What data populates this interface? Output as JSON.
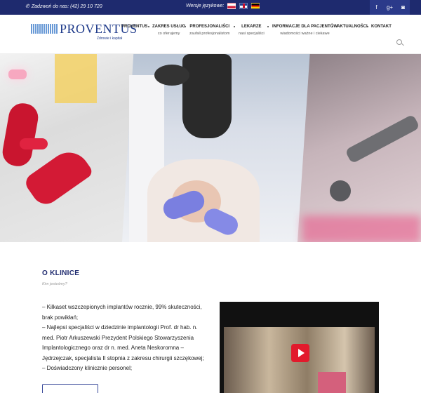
{
  "topbar": {
    "phone": "Zadzwoń do nas: (42) 29 10 720",
    "versions_label": "Wersje językowe:",
    "flags": [
      "flag-pl",
      "flag-en",
      "flag-de"
    ],
    "social": [
      {
        "icon": "facebook-icon",
        "glyph": "f"
      },
      {
        "icon": "google-plus-icon",
        "glyph": "g+"
      },
      {
        "icon": "instagram-icon",
        "glyph": "◙"
      }
    ],
    "background": "#1e2a6e"
  },
  "logo": {
    "wordmark": "PROVENTUS",
    "tagline": "Zdrowie i kapitał"
  },
  "nav": [
    {
      "label": "PROVENTUS",
      "sub": ""
    },
    {
      "label": "ZAKRES USŁUG",
      "sub": "co oferujemy"
    },
    {
      "label": "PROFESJONALIŚCI",
      "sub": "zaufali profesjonalistom"
    },
    {
      "label": "LEKARZE",
      "sub": "nasi specjaliści"
    },
    {
      "label": "INFORMACJE DLA PACJENTÓW",
      "sub": "wiadomości ważne i ciekawe"
    },
    {
      "label": "AKTUALNOŚCI",
      "sub": ""
    },
    {
      "label": "KONTAKT",
      "sub": ""
    }
  ],
  "about": {
    "title": "O KLINICE",
    "subtitle": "Kim jesteśmy?",
    "lines": [
      "– Kilkaset wszczepionych implantów rocznie, 99% skuteczności,",
      "brak powikłań;",
      "– Najlepsi specjaliści w dziedzinie implantologii Prof. dr hab. n.",
      "med. Piotr Arkuszewski Prezydent Polskiego Stowarzyszenia",
      "Implantologicznego oraz dr n. med. Aneta Neskoromna –",
      "Jędrzejczak, specjalista II stopnia z zakresu chirurgii szczękowej;",
      "– Doświadczony klinicznie personel;"
    ]
  },
  "colors": {
    "brand": "#1e2a6e",
    "logo_blue": "#1e3a8a",
    "play_red": "#e21a2c"
  }
}
